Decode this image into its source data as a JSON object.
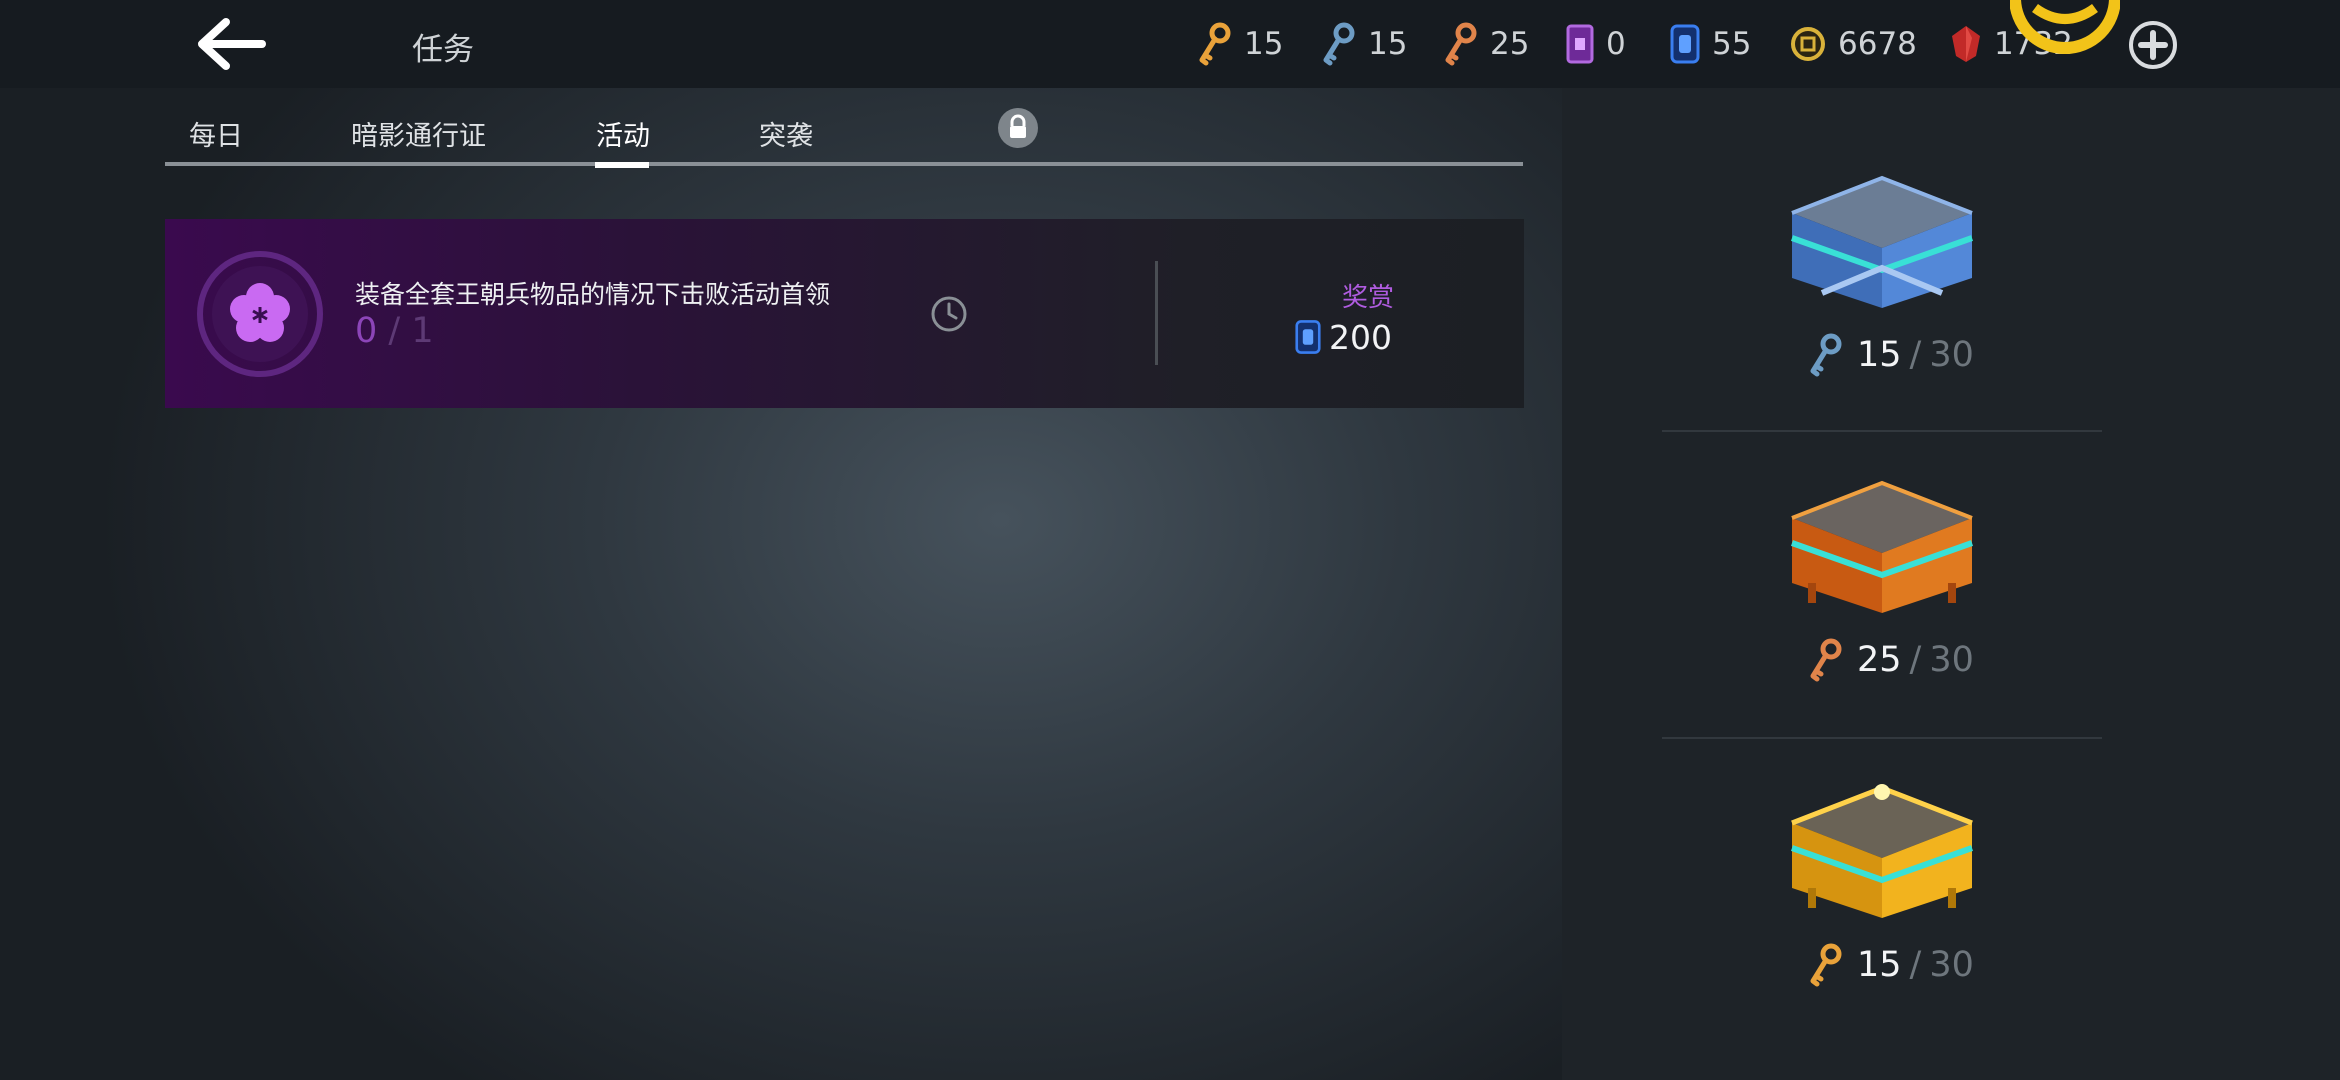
{
  "header": {
    "title": "任务",
    "currencies": [
      {
        "icon": "gold-key-icon",
        "amount": "15",
        "color": "#e9a23a"
      },
      {
        "icon": "blue-key-icon",
        "amount": "15",
        "color": "#6d9cc4"
      },
      {
        "icon": "orange-key-icon",
        "amount": "25",
        "color": "#e0844a"
      },
      {
        "icon": "purple-ticket-icon",
        "amount": "0",
        "color": "#9a4fd0"
      },
      {
        "icon": "blue-card-icon",
        "amount": "55",
        "color": "#2f6fd6"
      },
      {
        "icon": "gold-coin-icon",
        "amount": "6678",
        "color": "#d9b23a"
      },
      {
        "icon": "red-gem-icon",
        "amount": "1732",
        "color": "#d2322e"
      }
    ]
  },
  "tabs": [
    {
      "label": "每日",
      "active": false
    },
    {
      "label": "暗影通行证",
      "active": false
    },
    {
      "label": "活动",
      "active": true
    },
    {
      "label": "突袭",
      "active": false,
      "locked": true
    }
  ],
  "task": {
    "description": "装备全套王朝兵物品的情况下击败活动首领",
    "progress_current": "0",
    "progress_sep": "/",
    "progress_total": "1",
    "reward_label": "奖赏",
    "reward_amount": "200",
    "reward_icon": "blue-card-icon"
  },
  "chests": [
    {
      "name": "blue-chest",
      "key_icon": "blue-key-icon",
      "have": "15",
      "sep": "/",
      "max": "30"
    },
    {
      "name": "orange-chest",
      "key_icon": "orange-key-icon",
      "have": "25",
      "sep": "/",
      "max": "30"
    },
    {
      "name": "gold-chest",
      "key_icon": "gold-key-icon",
      "have": "15",
      "sep": "/",
      "max": "30"
    }
  ],
  "colors": {
    "accent_purple": "#b05ce0",
    "progress_purple": "#8c45b8",
    "topbar": "#161b20",
    "panel": "#1e2328"
  }
}
